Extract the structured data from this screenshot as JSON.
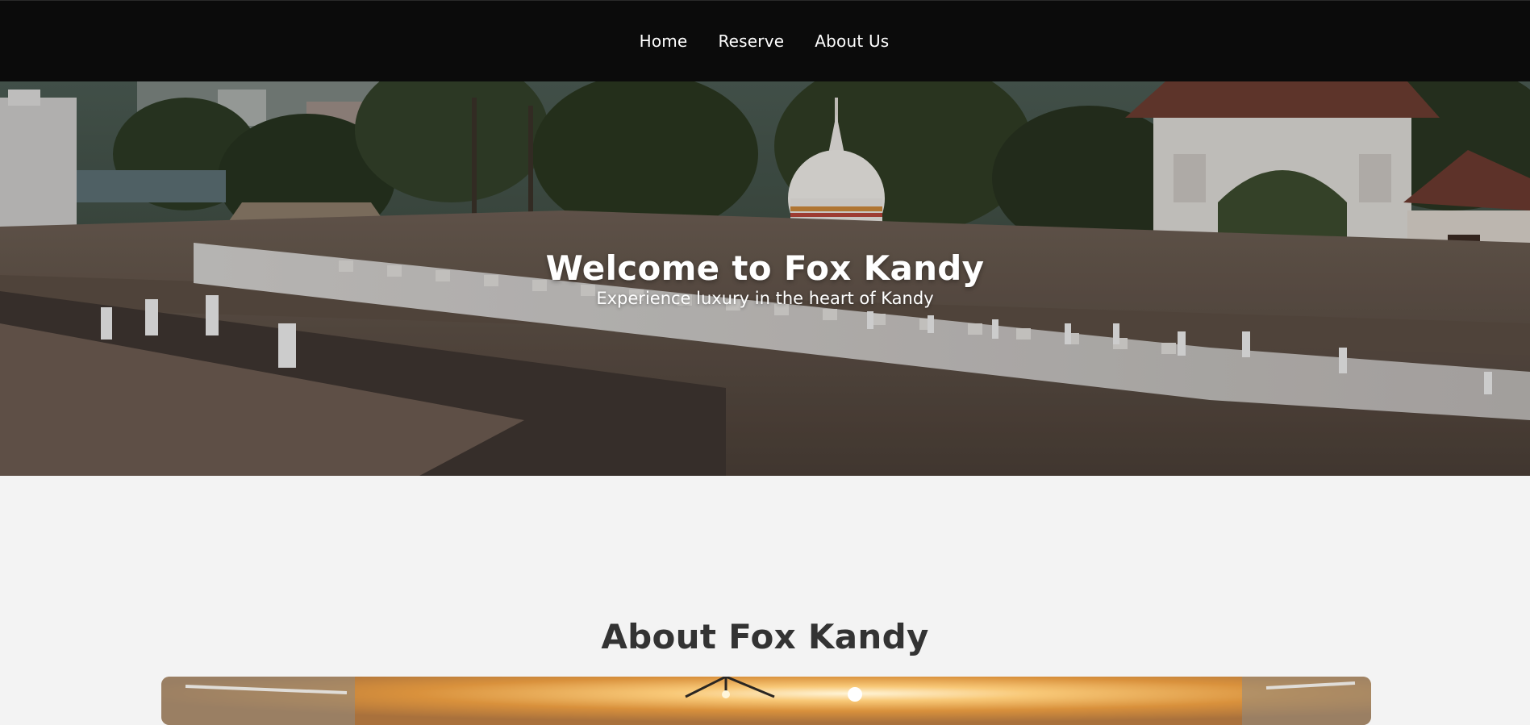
{
  "nav": {
    "items": [
      {
        "label": "Home"
      },
      {
        "label": "Reserve"
      },
      {
        "label": "About Us"
      }
    ]
  },
  "hero": {
    "title": "Welcome to Fox Kandy",
    "subtitle": "Experience luxury in the heart of Kandy",
    "image_icon": "temple-photo"
  },
  "about": {
    "title": "About Fox Kandy",
    "image_icon": "sunset-photo"
  },
  "colors": {
    "nav_bg": "#0b0b0b",
    "page_bg": "#f3f3f3",
    "heading_dark": "#333333",
    "hero_text": "#ffffff"
  }
}
